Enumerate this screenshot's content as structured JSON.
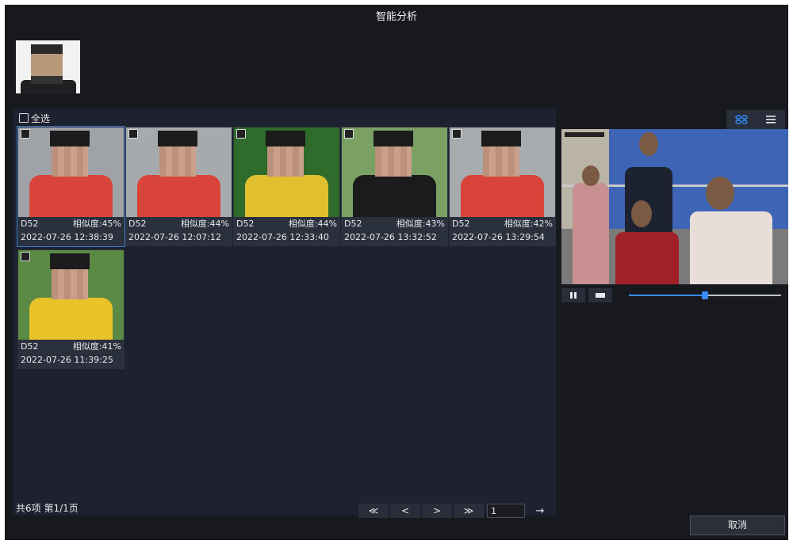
{
  "window": {
    "title": "智能分析"
  },
  "results": {
    "select_all_label": "全选",
    "cards": [
      {
        "camera": "D52",
        "similarity": "相似度:45%",
        "timestamp": "2022-07-26 12:38:39",
        "selected": true,
        "shirt_color": "#d9443a",
        "bg_color": "#9fa3a8"
      },
      {
        "camera": "D52",
        "similarity": "相似度:44%",
        "timestamp": "2022-07-26 12:07:12",
        "selected": false,
        "shirt_color": "#d9443a",
        "bg_color": "#a7aaad"
      },
      {
        "camera": "D52",
        "similarity": "相似度:44%",
        "timestamp": "2022-07-26 12:33:40",
        "selected": false,
        "shirt_color": "#e0c02e",
        "bg_color": "#2f6b2a"
      },
      {
        "camera": "D52",
        "similarity": "相似度:43%",
        "timestamp": "2022-07-26 13:32:52",
        "selected": false,
        "shirt_color": "#1b1b1b",
        "bg_color": "#7aa063"
      },
      {
        "camera": "D52",
        "similarity": "相似度:42%",
        "timestamp": "2022-07-26 13:29:54",
        "selected": false,
        "shirt_color": "#d9443a",
        "bg_color": "#a8abae"
      },
      {
        "camera": "D52",
        "similarity": "相似度:41%",
        "timestamp": "2022-07-26 11:39:25",
        "selected": false,
        "shirt_color": "#e8c32a",
        "bg_color": "#5a8a44"
      }
    ]
  },
  "pagination": {
    "summary": "共6项 第1/1页",
    "first_label": "≪",
    "prev_label": "<",
    "next_label": ">",
    "last_label": "≫",
    "page_value": "1",
    "go_label": "→"
  },
  "player": {
    "progress_fraction": 0.5
  },
  "cancel_label": "取消",
  "colors": {
    "accent": "#3b8bff",
    "panel": "#1e2230",
    "window": "#17191e"
  }
}
